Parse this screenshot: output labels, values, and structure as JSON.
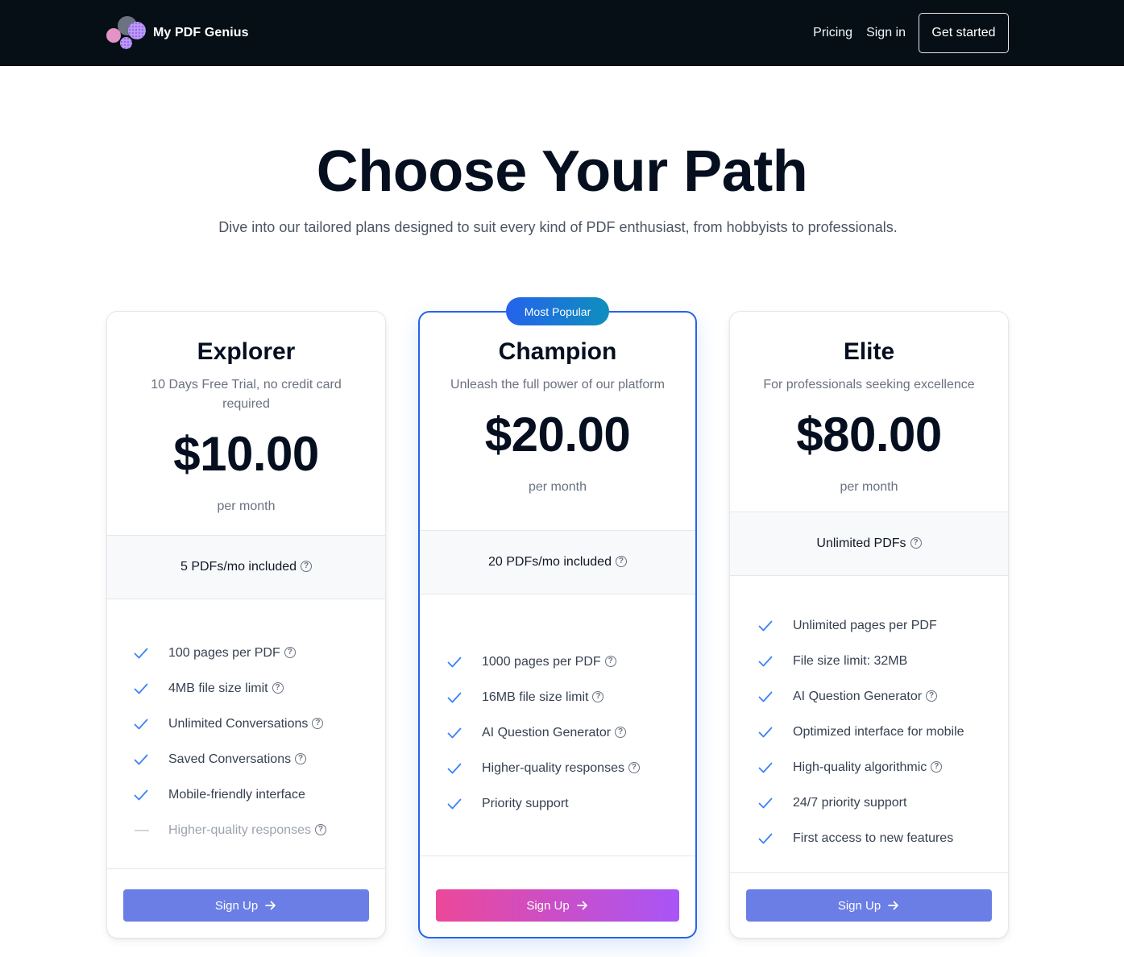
{
  "nav": {
    "brand": "My PDF Genius",
    "links": [
      {
        "label": "Pricing"
      },
      {
        "label": "Sign in"
      }
    ],
    "cta": "Get started"
  },
  "hero": {
    "title": "Choose Your Path",
    "subtitle": "Dive into our tailored plans designed to suit every kind of PDF enthusiast, from hobbyists to professionals."
  },
  "colors": {
    "nav_bg": "#050f15",
    "accent_blue": "#2663eb",
    "check_blue": "#3b82f6",
    "signup_button": "#6a7ee6",
    "featured_gradient_start": "#ec4899",
    "featured_gradient_end": "#a855f7"
  },
  "plans": [
    {
      "name": "Explorer",
      "description": "10 Days Free Trial, no credit card required",
      "price": "$10.00",
      "period": "per month",
      "quota": "5 PDFs/mo included",
      "quota_help": true,
      "features": [
        {
          "label": "100 pages per PDF",
          "included": true,
          "help": true
        },
        {
          "label": "4MB file size limit",
          "included": true,
          "help": true
        },
        {
          "label": "Unlimited Conversations",
          "included": true,
          "help": true
        },
        {
          "label": "Saved Conversations",
          "included": true,
          "help": true
        },
        {
          "label": "Mobile-friendly interface",
          "included": true,
          "help": false
        },
        {
          "label": "Higher-quality responses",
          "included": false,
          "help": true
        }
      ],
      "button": "Sign Up"
    },
    {
      "name": "Champion",
      "badge": "Most Popular",
      "description": "Unleash the full power of our platform",
      "price": "$20.00",
      "period": "per month",
      "quota": "20 PDFs/mo included",
      "quota_help": true,
      "features": [
        {
          "label": "1000 pages per PDF",
          "included": true,
          "help": true
        },
        {
          "label": "16MB file size limit",
          "included": true,
          "help": true
        },
        {
          "label": "AI Question Generator",
          "included": true,
          "help": true
        },
        {
          "label": "Higher-quality responses",
          "included": true,
          "help": true
        },
        {
          "label": "Priority support",
          "included": true,
          "help": false
        }
      ],
      "button": "Sign Up"
    },
    {
      "name": "Elite",
      "description": "For professionals seeking excellence",
      "price": "$80.00",
      "period": "per month",
      "quota": "Unlimited PDFs",
      "quota_help": true,
      "features": [
        {
          "label": "Unlimited pages per PDF",
          "included": true,
          "help": false
        },
        {
          "label": "File size limit: 32MB",
          "included": true,
          "help": false
        },
        {
          "label": "AI Question Generator",
          "included": true,
          "help": true
        },
        {
          "label": "Optimized interface for mobile",
          "included": true,
          "help": false
        },
        {
          "label": "High-quality algorithmic",
          "included": true,
          "help": true
        },
        {
          "label": "24/7 priority support",
          "included": true,
          "help": false
        },
        {
          "label": "First access to new features",
          "included": true,
          "help": false
        }
      ],
      "button": "Sign Up"
    }
  ],
  "icons": {
    "help": "?",
    "check": "check-icon",
    "dash": "dash-icon",
    "arrow": "arrow-right-icon"
  }
}
